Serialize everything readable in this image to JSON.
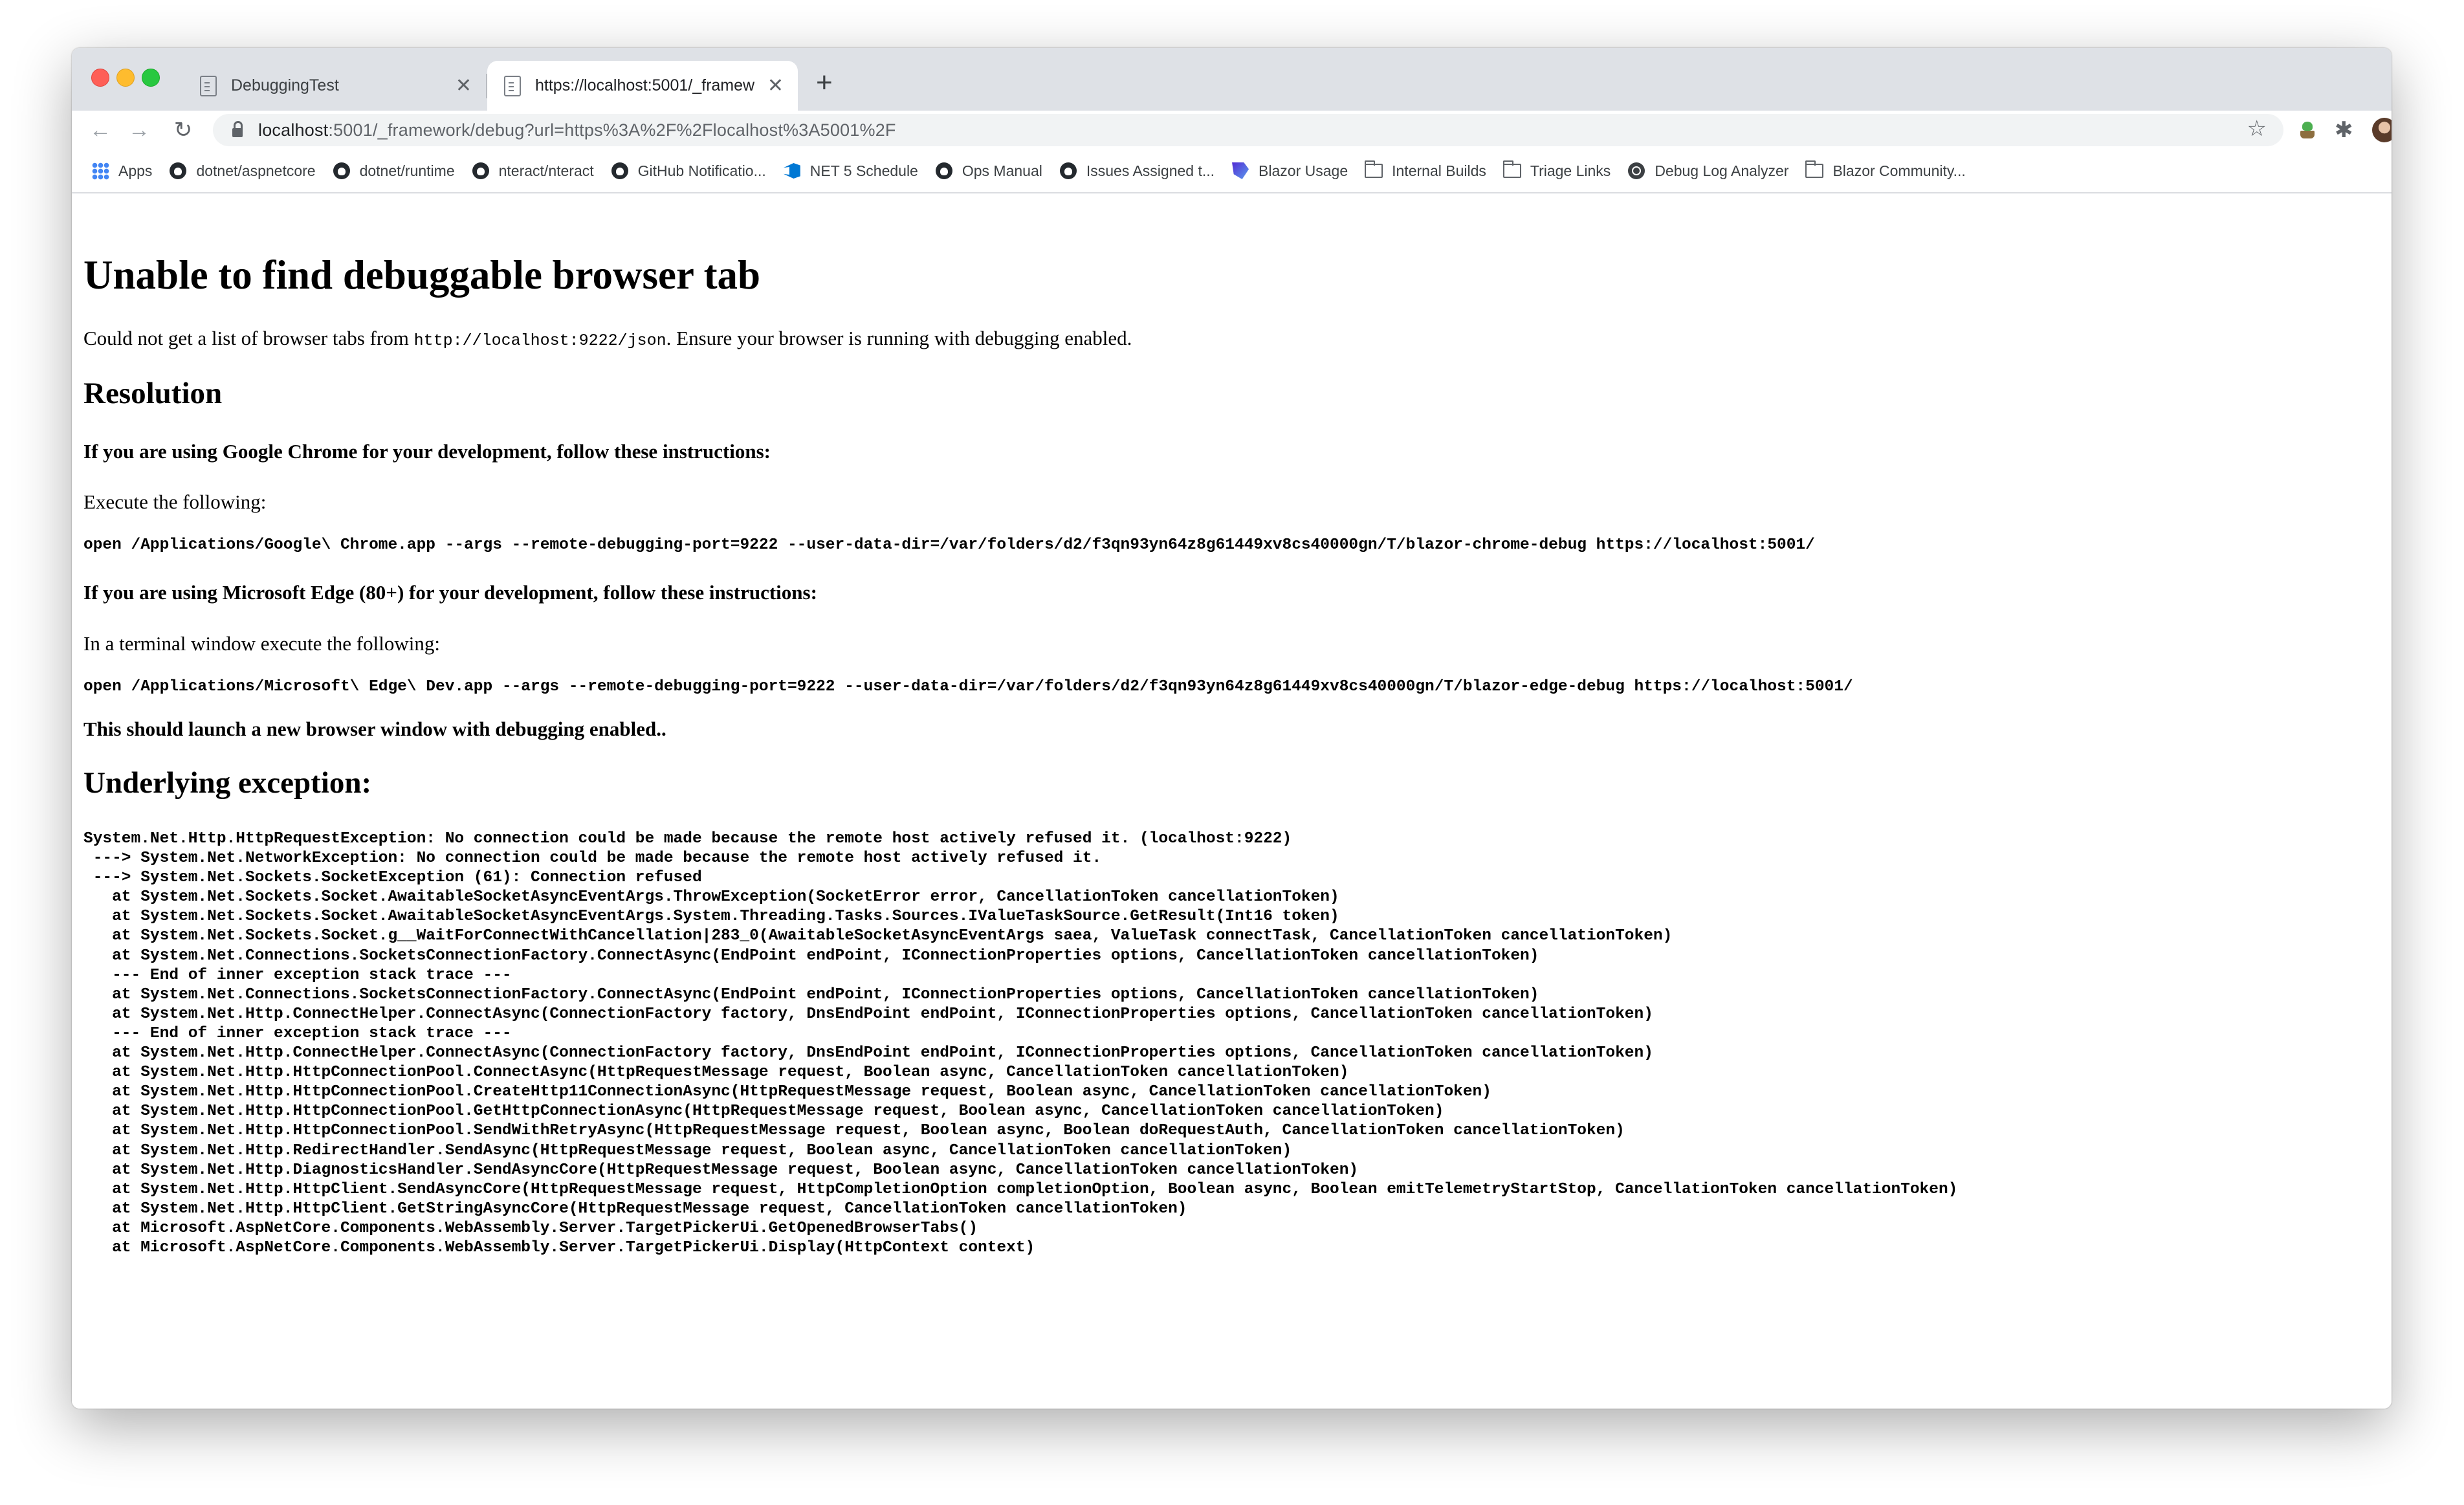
{
  "browser": {
    "tabs": [
      {
        "title": "DebuggingTest",
        "active": false
      },
      {
        "title": "https://localhost:5001/_framew",
        "active": true
      }
    ],
    "address": {
      "host": "localhost",
      "rest": ":5001/_framework/debug?url=https%3A%2F%2Flocalhost%3A5001%2F"
    },
    "bookmarks": [
      {
        "label": "Apps",
        "icon": "apps-grid-icon"
      },
      {
        "label": "dotnet/aspnetcore",
        "icon": "github-icon"
      },
      {
        "label": "dotnet/runtime",
        "icon": "github-icon"
      },
      {
        "label": "nteract/nteract",
        "icon": "github-icon"
      },
      {
        "label": "GitHub Notificatio...",
        "icon": "github-icon"
      },
      {
        "label": "NET 5 Schedule",
        "icon": "azure-devops-icon"
      },
      {
        "label": "Ops Manual",
        "icon": "github-icon"
      },
      {
        "label": "Issues Assigned t...",
        "icon": "github-icon"
      },
      {
        "label": "Blazor Usage",
        "icon": "blazor-icon"
      },
      {
        "label": "Internal Builds",
        "icon": "folder-icon"
      },
      {
        "label": "Triage Links",
        "icon": "folder-icon"
      },
      {
        "label": "Debug Log Analyzer",
        "icon": "globe-icon"
      },
      {
        "label": "Blazor Community...",
        "icon": "folder-icon"
      }
    ]
  },
  "page": {
    "title": "Unable to find debuggable browser tab",
    "intro_prefix": "Could not get a list of browser tabs from ",
    "intro_code": "http://localhost:9222/json",
    "intro_suffix": ". Ensure your browser is running with debugging enabled.",
    "resolution_heading": "Resolution",
    "chrome_heading": "If you are using Google Chrome for your development, follow these instructions:",
    "chrome_execute": "Execute the following:",
    "chrome_command": "open /Applications/Google\\ Chrome.app --args --remote-debugging-port=9222 --user-data-dir=/var/folders/d2/f3qn93yn64z8g61449xv8cs40000gn/T/blazor-chrome-debug https://localhost:5001/",
    "edge_heading": "If you are using Microsoft Edge (80+) for your development, follow these instructions:",
    "edge_execute": "In a terminal window execute the following:",
    "edge_command": "open /Applications/Microsoft\\ Edge\\ Dev.app --args --remote-debugging-port=9222 --user-data-dir=/var/folders/d2/f3qn93yn64z8g61449xv8cs40000gn/T/blazor-edge-debug https://localhost:5001/",
    "launch_note": "This should launch a new browser window with debugging enabled..",
    "exception_heading": "Underlying exception:",
    "stack_trace": "System.Net.Http.HttpRequestException: No connection could be made because the remote host actively refused it. (localhost:9222)\n ---> System.Net.NetworkException: No connection could be made because the remote host actively refused it.\n ---> System.Net.Sockets.SocketException (61): Connection refused\n   at System.Net.Sockets.Socket.AwaitableSocketAsyncEventArgs.ThrowException(SocketError error, CancellationToken cancellationToken)\n   at System.Net.Sockets.Socket.AwaitableSocketAsyncEventArgs.System.Threading.Tasks.Sources.IValueTaskSource.GetResult(Int16 token)\n   at System.Net.Sockets.Socket.g__WaitForConnectWithCancellation|283_0(AwaitableSocketAsyncEventArgs saea, ValueTask connectTask, CancellationToken cancellationToken)\n   at System.Net.Connections.SocketsConnectionFactory.ConnectAsync(EndPoint endPoint, IConnectionProperties options, CancellationToken cancellationToken)\n   --- End of inner exception stack trace ---\n   at System.Net.Connections.SocketsConnectionFactory.ConnectAsync(EndPoint endPoint, IConnectionProperties options, CancellationToken cancellationToken)\n   at System.Net.Http.ConnectHelper.ConnectAsync(ConnectionFactory factory, DnsEndPoint endPoint, IConnectionProperties options, CancellationToken cancellationToken)\n   --- End of inner exception stack trace ---\n   at System.Net.Http.ConnectHelper.ConnectAsync(ConnectionFactory factory, DnsEndPoint endPoint, IConnectionProperties options, CancellationToken cancellationToken)\n   at System.Net.Http.HttpConnectionPool.ConnectAsync(HttpRequestMessage request, Boolean async, CancellationToken cancellationToken)\n   at System.Net.Http.HttpConnectionPool.CreateHttp11ConnectionAsync(HttpRequestMessage request, Boolean async, CancellationToken cancellationToken)\n   at System.Net.Http.HttpConnectionPool.GetHttpConnectionAsync(HttpRequestMessage request, Boolean async, CancellationToken cancellationToken)\n   at System.Net.Http.HttpConnectionPool.SendWithRetryAsync(HttpRequestMessage request, Boolean async, Boolean doRequestAuth, CancellationToken cancellationToken)\n   at System.Net.Http.RedirectHandler.SendAsync(HttpRequestMessage request, Boolean async, CancellationToken cancellationToken)\n   at System.Net.Http.DiagnosticsHandler.SendAsyncCore(HttpRequestMessage request, Boolean async, CancellationToken cancellationToken)\n   at System.Net.Http.HttpClient.SendAsyncCore(HttpRequestMessage request, HttpCompletionOption completionOption, Boolean async, Boolean emitTelemetryStartStop, CancellationToken cancellationToken)\n   at System.Net.Http.HttpClient.GetStringAsyncCore(HttpRequestMessage request, CancellationToken cancellationToken)\n   at Microsoft.AspNetCore.Components.WebAssembly.Server.TargetPickerUi.GetOpenedBrowserTabs()\n   at Microsoft.AspNetCore.Components.WebAssembly.Server.TargetPickerUi.Display(HttpContext context)"
  }
}
